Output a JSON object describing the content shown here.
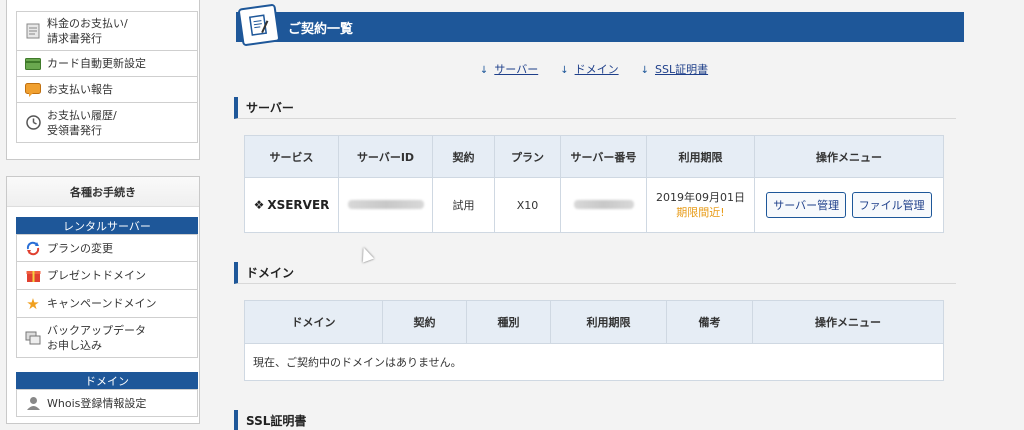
{
  "sidebar": {
    "top_items": [
      {
        "icon": "invoice-icon",
        "label": "料金のお支払い/\n請求書発行"
      },
      {
        "icon": "credit-card-icon",
        "label": "カード自動更新設定"
      },
      {
        "icon": "payment-report-icon",
        "label": "お支払い報告"
      },
      {
        "icon": "history-clock-icon",
        "label": "お支払い履歴/\n受領書発行"
      }
    ],
    "procedures_title": "各種お手続き",
    "rental_server_header": "レンタルサーバー",
    "rental_items": [
      {
        "icon": "plan-change-icon",
        "label": "プランの変更"
      },
      {
        "icon": "gift-icon",
        "label": "プレゼントドメイン"
      },
      {
        "icon": "star-icon",
        "label": "キャンペーンドメイン"
      },
      {
        "icon": "backup-icon",
        "label": "バックアップデータ\nお申し込み"
      }
    ],
    "domain_header": "ドメイン",
    "domain_items": [
      {
        "icon": "user-icon",
        "label": "Whois登録情報設定"
      }
    ]
  },
  "main": {
    "title": "ご契約一覧",
    "anchors": [
      "サーバー",
      "ドメイン",
      "SSL証明書"
    ],
    "server_section": {
      "heading": "サーバー",
      "columns": [
        "サービス",
        "サーバーID",
        "契約",
        "プラン",
        "サーバー番号",
        "利用期限",
        "操作メニュー"
      ],
      "row": {
        "service": "XSERVER",
        "contract": "試用",
        "plan": "X10",
        "expiry_date": "2019年09月01日",
        "expiry_warning": "期限間近!",
        "actions": [
          "サーバー管理",
          "ファイル管理"
        ]
      }
    },
    "domain_section": {
      "heading": "ドメイン",
      "columns": [
        "ドメイン",
        "契約",
        "種別",
        "利用期限",
        "備考",
        "操作メニュー"
      ],
      "empty_message": "現在、ご契約中のドメインはありません。"
    },
    "ssl_section": {
      "heading": "SSL証明書"
    }
  },
  "colors": {
    "accent": "#1e5799",
    "warning": "#e89b17",
    "table_header": "#e6edf5"
  }
}
